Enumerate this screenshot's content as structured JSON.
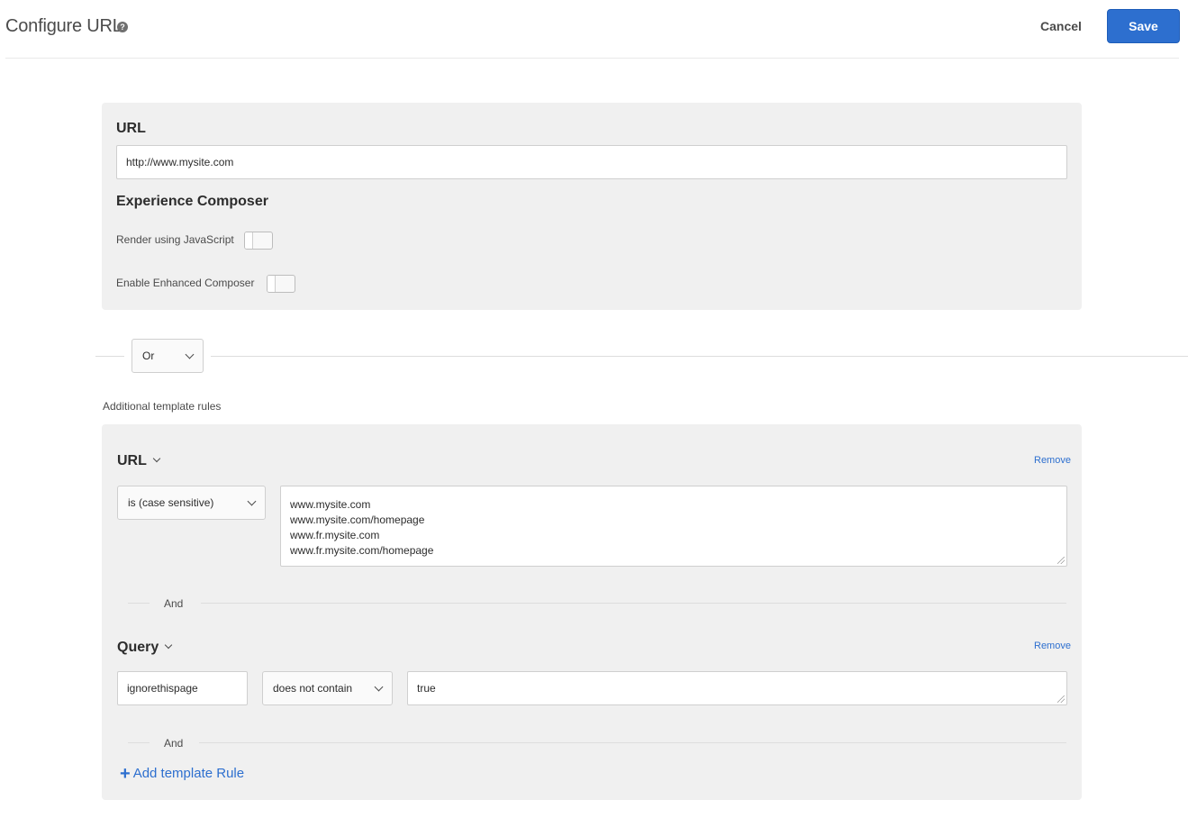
{
  "header": {
    "title": "Configure URL",
    "help_icon": "question-circle-icon",
    "cancel_label": "Cancel",
    "save_label": "Save"
  },
  "colors": {
    "accent": "#2d6fcf",
    "panel_bg": "#f0f0f0"
  },
  "url_section": {
    "heading": "URL",
    "url_value": "http://www.mysite.com",
    "composer_heading": "Experience Composer",
    "render_js_label": "Render using JavaScript",
    "render_js_on": false,
    "enhanced_label": "Enable Enhanced Composer",
    "enhanced_on": false
  },
  "combinator": {
    "value": "Or"
  },
  "template_rules": {
    "heading": "Additional template rules",
    "url_rule": {
      "field": "URL",
      "remove_label": "Remove",
      "operator": "is (case sensitive)",
      "values": [
        "www.mysite.com",
        "www.mysite.com/homepage",
        "www.fr.mysite.com",
        "www.fr.mysite.com/homepage"
      ]
    },
    "and_label_1": "And",
    "query_rule": {
      "field": "Query",
      "remove_label": "Remove",
      "param": "ignorethispage",
      "operator": "does not contain",
      "value": "true"
    },
    "and_label_2": "And",
    "add_rule_label": "Add template Rule"
  }
}
